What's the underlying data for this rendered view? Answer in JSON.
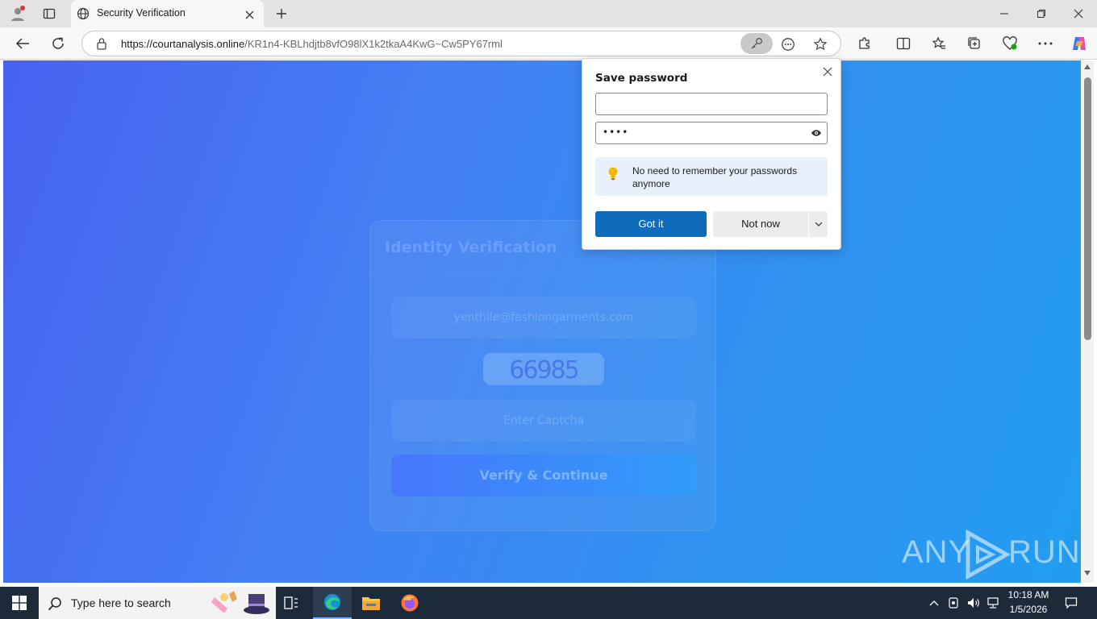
{
  "browser": {
    "tab_title": "Security Verification",
    "url_host": "https://courtanalysis.online",
    "url_path": "/KR1n4-KBLhdjtb8vfO98lX1k2tkaA4KwG~Cw5PY67rml",
    "window_controls": [
      "minimize",
      "restore",
      "close"
    ]
  },
  "page": {
    "card_title": "Identity Verification",
    "email_value": "yenthile@fashiongarments.com",
    "captcha_code": "66985",
    "captcha_placeholder": "Enter Captcha",
    "verify_button": "Verify & Continue",
    "watermark_left": "ANY",
    "watermark_right": "RUN"
  },
  "save_password": {
    "title": "Save password",
    "username_value": "",
    "password_value": "••••",
    "tip_text": "No need to remember your passwords anymore",
    "got_it_label": "Got it",
    "not_now_label": "Not now"
  },
  "taskbar": {
    "search_placeholder": "Type here to search",
    "time": "10:18 AM",
    "date": "1/5/2026"
  },
  "colors": {
    "accent": "#0f6cbd",
    "page_gradient_start": "#4a63f5",
    "page_gradient_end": "#1fa6f5"
  }
}
